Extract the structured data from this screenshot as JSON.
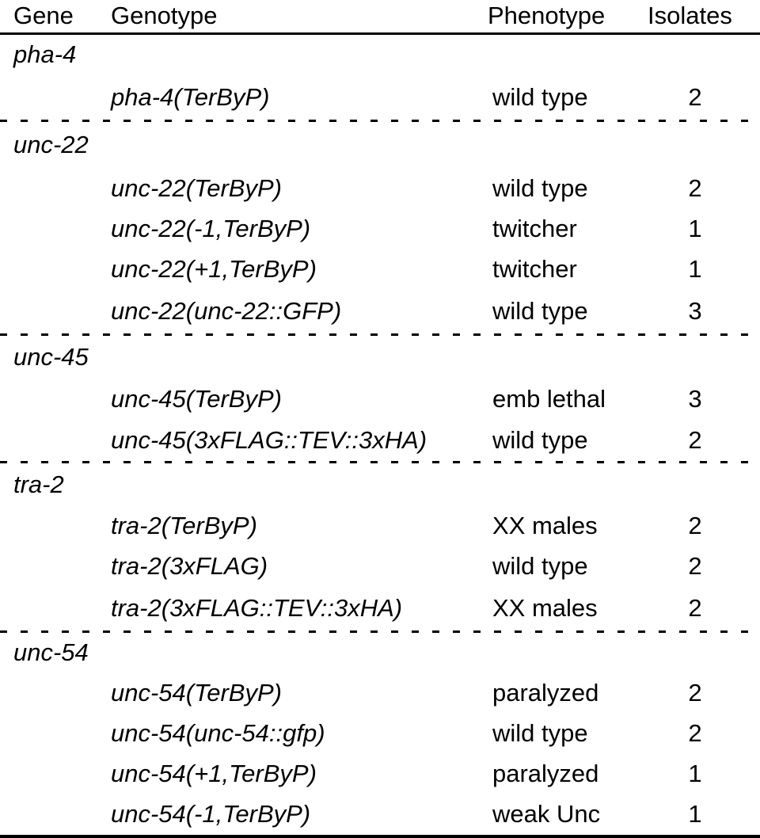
{
  "table": {
    "columns": {
      "gene": "Gene",
      "genotype": "Genotype",
      "phenotype": "Phenotype",
      "isolates": "Isolates"
    },
    "sections": [
      {
        "gene": "pha-4",
        "rows": [
          {
            "genotype": "pha-4(TerByP)",
            "phenotype": "wild type",
            "isolates": "2"
          }
        ]
      },
      {
        "gene": "unc-22",
        "rows": [
          {
            "genotype": "unc-22(TerByP)",
            "phenotype": "wild type",
            "isolates": "2"
          },
          {
            "genotype": "unc-22(-1,TerByP)",
            "phenotype": "twitcher",
            "isolates": "1"
          },
          {
            "genotype": "unc-22(+1,TerByP)",
            "phenotype": "twitcher",
            "isolates": "1"
          },
          {
            "genotype": "unc-22(unc-22::GFP)",
            "phenotype": "wild type",
            "isolates": "3"
          }
        ]
      },
      {
        "gene": "unc-45",
        "rows": [
          {
            "genotype": "unc-45(TerByP)",
            "phenotype": "emb lethal",
            "isolates": "3"
          },
          {
            "genotype": "unc-45(3xFLAG::TEV::3xHA)",
            "phenotype": "wild type",
            "isolates": "2"
          }
        ]
      },
      {
        "gene": "tra-2",
        "rows": [
          {
            "genotype": "tra-2(TerByP)",
            "phenotype": "XX males",
            "isolates": "2"
          },
          {
            "genotype": "tra-2(3xFLAG)",
            "phenotype": "wild type",
            "isolates": "2"
          },
          {
            "genotype": "tra-2(3xFLAG::TEV::3xHA)",
            "phenotype": "XX males",
            "isolates": "2"
          }
        ]
      },
      {
        "gene": "unc-54",
        "rows": [
          {
            "genotype": "unc-54(TerByP)",
            "phenotype": "paralyzed",
            "isolates": "2"
          },
          {
            "genotype": "unc-54(unc-54::gfp)",
            "phenotype": "wild type",
            "isolates": "2"
          },
          {
            "genotype": "unc-54(+1,TerByP)",
            "phenotype": "paralyzed",
            "isolates": "1"
          },
          {
            "genotype": "unc-54(-1,TerByP)",
            "phenotype": "weak Unc",
            "isolates": "1"
          }
        ]
      }
    ]
  },
  "colors": {
    "text": "#000000",
    "background": "#ffffff",
    "rule": "#000000"
  }
}
